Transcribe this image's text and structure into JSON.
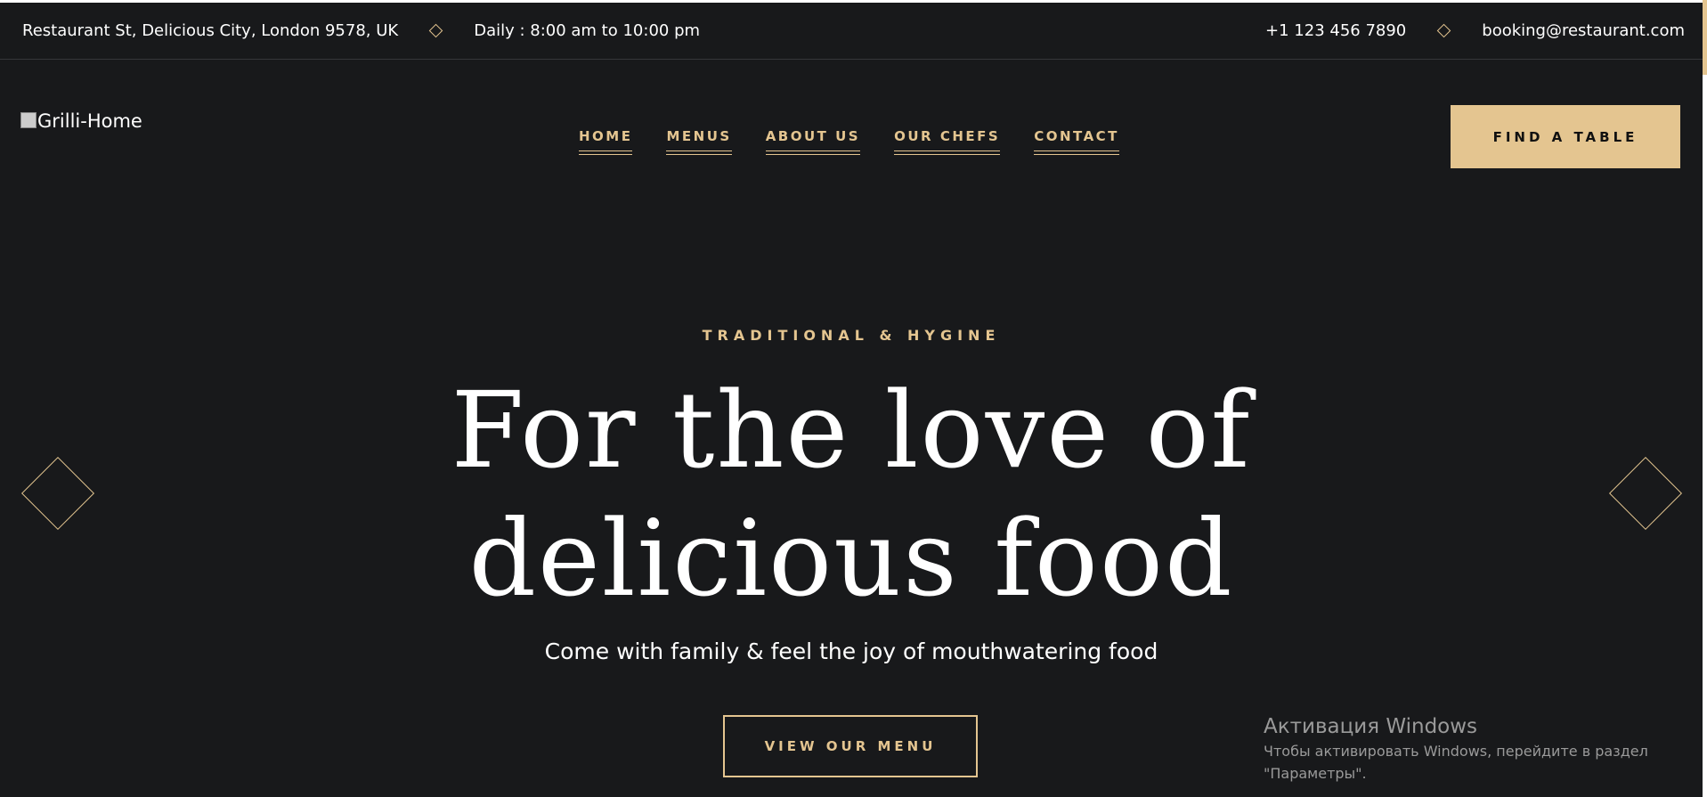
{
  "topbar": {
    "address": "Restaurant St, Delicious City, London 9578, UK",
    "hours": "Daily : 8:00 am to 10:00 pm",
    "phone": "+1 123 456 7890",
    "email": "booking@restaurant.com"
  },
  "header": {
    "logo_alt": "Grilli-Home",
    "nav": [
      "HOME",
      "MENUS",
      "ABOUT US",
      "OUR CHEFS",
      "CONTACT"
    ],
    "cta_label": "FIND A TABLE"
  },
  "hero": {
    "subtitle": "TRADITIONAL & HYGINE",
    "headline_line1": "For the love of",
    "headline_line2": "delicious food",
    "tagline": "Come with family & feel the joy of mouthwatering food",
    "button_label": "VIEW OUR MENU"
  },
  "watermark": {
    "title": "Активация Windows",
    "line1": "Чтобы активировать Windows, перейдите в раздел",
    "line2": "\"Параметры\"."
  },
  "colors": {
    "background": "#18191b",
    "accent": "#e4c590",
    "text": "#ffffff"
  },
  "icons": {
    "separator": "diamond-icon",
    "slider_prev": "diamond-arrow-icon",
    "slider_next": "diamond-arrow-icon",
    "logo": "broken-image-icon"
  }
}
